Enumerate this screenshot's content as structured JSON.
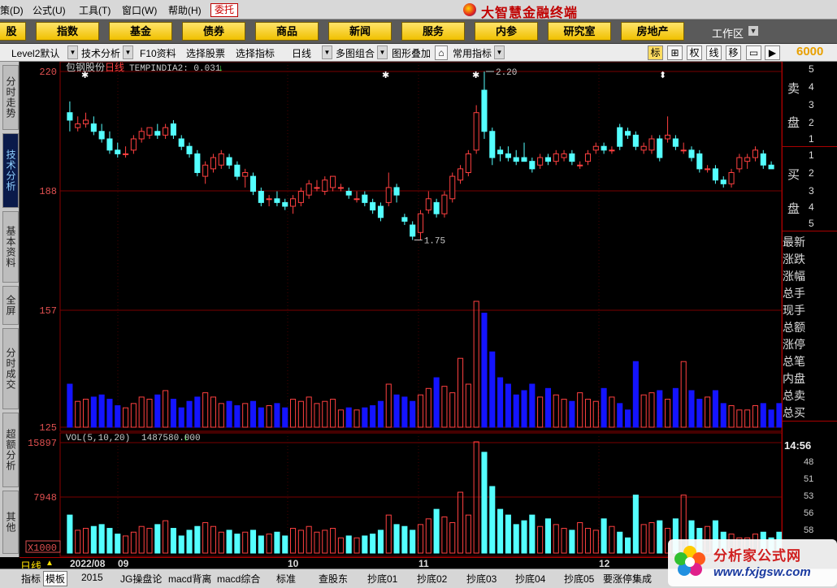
{
  "menu": [
    "策(D)",
    "公式(U)",
    "工具(T)",
    "窗口(W)",
    "帮助(H)"
  ],
  "wt_button": "委托",
  "app_title": "大智慧金融终端",
  "nav_buttons": [
    "股",
    "指数",
    "基金",
    "债券",
    "商品",
    "新闻",
    "服务",
    "内参",
    "研究室",
    "房地产"
  ],
  "workspace_label": "工作区",
  "toolbar": {
    "level2": "Level2默认",
    "tech": "技术分析",
    "f10": "F10资料",
    "select_stock": "选择股票",
    "select_indicator": "选择指标",
    "period": "日线",
    "multi": "多图组合",
    "overlay": "图形叠加",
    "common": "常用指标",
    "icons": [
      "标",
      "⊞",
      "权",
      "线",
      "移"
    ],
    "code": "6000"
  },
  "left_tabs": [
    "分时走势",
    "技术分析",
    "基本资料",
    "全屏",
    "分时成交",
    "超额分析",
    "其他"
  ],
  "chart": {
    "stock_name": "包钢股份",
    "period_tag": "日线",
    "indicator": "TEMPINDI",
    "indicator_value": "A2: 0.031",
    "price_axis": [
      "220",
      "188",
      "157",
      "125"
    ],
    "max_label": "2.20",
    "min_label": "1.75",
    "vol_label": "VOL(5,10,20)",
    "vol_value": "1487580.000",
    "vol_axis": [
      "15897",
      "7948"
    ],
    "vol_unit": "X1000",
    "colors": {
      "up": "#ff4040",
      "down": "#54ffff",
      "volume_bar": "#1414ff",
      "grid": "#7a0000"
    }
  },
  "chart_data": {
    "type": "candlestick",
    "candles": [
      {
        "o": 2.09,
        "h": 2.12,
        "l": 2.04,
        "c": 2.07
      },
      {
        "o": 2.05,
        "h": 2.08,
        "l": 2.04,
        "c": 2.06
      },
      {
        "o": 2.06,
        "h": 2.09,
        "l": 2.05,
        "c": 2.07
      },
      {
        "o": 2.06,
        "h": 2.08,
        "l": 2.03,
        "c": 2.04
      },
      {
        "o": 2.04,
        "h": 2.06,
        "l": 2.01,
        "c": 2.02
      },
      {
        "o": 2.02,
        "h": 2.04,
        "l": 1.98,
        "c": 1.99
      },
      {
        "o": 1.99,
        "h": 2.01,
        "l": 1.97,
        "c": 1.98
      },
      {
        "o": 1.98,
        "h": 2.0,
        "l": 1.97,
        "c": 1.98
      },
      {
        "o": 1.99,
        "h": 2.03,
        "l": 1.98,
        "c": 2.02
      },
      {
        "o": 2.02,
        "h": 2.05,
        "l": 2.01,
        "c": 2.04
      },
      {
        "o": 2.03,
        "h": 2.05,
        "l": 2.02,
        "c": 2.05
      },
      {
        "o": 2.04,
        "h": 2.06,
        "l": 2.02,
        "c": 2.03
      },
      {
        "o": 2.03,
        "h": 2.06,
        "l": 2.02,
        "c": 2.05
      },
      {
        "o": 2.06,
        "h": 2.07,
        "l": 2.02,
        "c": 2.03
      },
      {
        "o": 2.02,
        "h": 2.03,
        "l": 1.99,
        "c": 2.0
      },
      {
        "o": 2.0,
        "h": 2.01,
        "l": 1.97,
        "c": 1.98
      },
      {
        "o": 1.98,
        "h": 1.99,
        "l": 1.92,
        "c": 1.93
      },
      {
        "o": 1.92,
        "h": 1.96,
        "l": 1.9,
        "c": 1.95
      },
      {
        "o": 1.94,
        "h": 1.98,
        "l": 1.93,
        "c": 1.97
      },
      {
        "o": 1.95,
        "h": 1.99,
        "l": 1.94,
        "c": 1.98
      },
      {
        "o": 1.97,
        "h": 1.98,
        "l": 1.94,
        "c": 1.95
      },
      {
        "o": 1.95,
        "h": 1.96,
        "l": 1.91,
        "c": 1.92
      },
      {
        "o": 1.92,
        "h": 1.94,
        "l": 1.89,
        "c": 1.93
      },
      {
        "o": 1.92,
        "h": 1.93,
        "l": 1.87,
        "c": 1.88
      },
      {
        "o": 1.88,
        "h": 1.89,
        "l": 1.84,
        "c": 1.85
      },
      {
        "o": 1.86,
        "h": 1.87,
        "l": 1.84,
        "c": 1.86
      },
      {
        "o": 1.86,
        "h": 1.88,
        "l": 1.84,
        "c": 1.85
      },
      {
        "o": 1.85,
        "h": 1.86,
        "l": 1.83,
        "c": 1.84
      },
      {
        "o": 1.84,
        "h": 1.87,
        "l": 1.82,
        "c": 1.86
      },
      {
        "o": 1.85,
        "h": 1.89,
        "l": 1.84,
        "c": 1.88
      },
      {
        "o": 1.87,
        "h": 1.91,
        "l": 1.86,
        "c": 1.9
      },
      {
        "o": 1.89,
        "h": 1.91,
        "l": 1.88,
        "c": 1.89
      },
      {
        "o": 1.88,
        "h": 1.92,
        "l": 1.87,
        "c": 1.91
      },
      {
        "o": 1.89,
        "h": 1.92,
        "l": 1.88,
        "c": 1.92
      },
      {
        "o": 1.89,
        "h": 1.9,
        "l": 1.88,
        "c": 1.89
      },
      {
        "o": 1.88,
        "h": 1.89,
        "l": 1.86,
        "c": 1.87
      },
      {
        "o": 1.86,
        "h": 1.88,
        "l": 1.85,
        "c": 1.86
      },
      {
        "o": 1.87,
        "h": 1.88,
        "l": 1.84,
        "c": 1.85
      },
      {
        "o": 1.85,
        "h": 1.86,
        "l": 1.82,
        "c": 1.83
      },
      {
        "o": 1.84,
        "h": 1.85,
        "l": 1.8,
        "c": 1.81
      },
      {
        "o": 1.85,
        "h": 1.93,
        "l": 1.84,
        "c": 1.89
      },
      {
        "o": 1.89,
        "h": 1.9,
        "l": 1.85,
        "c": 1.87
      },
      {
        "o": 1.81,
        "h": 1.82,
        "l": 1.79,
        "c": 1.8
      },
      {
        "o": 1.79,
        "h": 1.8,
        "l": 1.75,
        "c": 1.76
      },
      {
        "o": 1.77,
        "h": 1.83,
        "l": 1.75,
        "c": 1.82
      },
      {
        "o": 1.83,
        "h": 1.88,
        "l": 1.82,
        "c": 1.86
      },
      {
        "o": 1.85,
        "h": 1.86,
        "l": 1.81,
        "c": 1.82
      },
      {
        "o": 1.82,
        "h": 1.88,
        "l": 1.81,
        "c": 1.87
      },
      {
        "o": 1.86,
        "h": 1.93,
        "l": 1.85,
        "c": 1.92
      },
      {
        "o": 1.91,
        "h": 1.95,
        "l": 1.9,
        "c": 1.94
      },
      {
        "o": 1.93,
        "h": 1.99,
        "l": 1.92,
        "c": 1.98
      },
      {
        "o": 1.99,
        "h": 2.11,
        "l": 1.98,
        "c": 2.09
      },
      {
        "o": 2.15,
        "h": 2.2,
        "l": 2.02,
        "c": 2.04
      },
      {
        "o": 2.04,
        "h": 2.05,
        "l": 1.95,
        "c": 1.97
      },
      {
        "o": 1.99,
        "h": 2.0,
        "l": 1.96,
        "c": 1.98
      },
      {
        "o": 1.98,
        "h": 2.0,
        "l": 1.96,
        "c": 1.97
      },
      {
        "o": 1.97,
        "h": 1.99,
        "l": 1.95,
        "c": 1.96
      },
      {
        "o": 1.97,
        "h": 2.01,
        "l": 1.96,
        "c": 1.96
      },
      {
        "o": 1.96,
        "h": 1.97,
        "l": 1.93,
        "c": 1.94
      },
      {
        "o": 1.95,
        "h": 1.98,
        "l": 1.94,
        "c": 1.97
      },
      {
        "o": 1.97,
        "h": 1.98,
        "l": 1.95,
        "c": 1.96
      },
      {
        "o": 1.96,
        "h": 1.99,
        "l": 1.95,
        "c": 1.98
      },
      {
        "o": 1.97,
        "h": 1.99,
        "l": 1.96,
        "c": 1.98
      },
      {
        "o": 1.98,
        "h": 1.99,
        "l": 1.95,
        "c": 1.96
      },
      {
        "o": 1.95,
        "h": 1.96,
        "l": 1.94,
        "c": 1.95
      },
      {
        "o": 1.96,
        "h": 1.99,
        "l": 1.95,
        "c": 1.98
      },
      {
        "o": 1.99,
        "h": 2.01,
        "l": 1.98,
        "c": 2.0
      },
      {
        "o": 2.0,
        "h": 2.01,
        "l": 1.98,
        "c": 1.99
      },
      {
        "o": 1.99,
        "h": 2.0,
        "l": 1.98,
        "c": 1.99
      },
      {
        "o": 2.05,
        "h": 2.06,
        "l": 1.99,
        "c": 2.0
      },
      {
        "o": 2.04,
        "h": 2.05,
        "l": 2.02,
        "c": 2.03
      },
      {
        "o": 2.03,
        "h": 2.04,
        "l": 1.99,
        "c": 2.0
      },
      {
        "o": 1.99,
        "h": 2.01,
        "l": 1.98,
        "c": 2.0
      },
      {
        "o": 1.99,
        "h": 2.03,
        "l": 1.98,
        "c": 2.02
      },
      {
        "o": 2.02,
        "h": 2.03,
        "l": 1.96,
        "c": 1.97
      },
      {
        "o": 2.02,
        "h": 2.08,
        "l": 2.01,
        "c": 2.03
      },
      {
        "o": 2.02,
        "h": 2.03,
        "l": 1.99,
        "c": 2.0
      },
      {
        "o": 1.99,
        "h": 2.01,
        "l": 1.98,
        "c": 1.99
      },
      {
        "o": 1.99,
        "h": 2.0,
        "l": 1.96,
        "c": 1.97
      },
      {
        "o": 1.98,
        "h": 1.99,
        "l": 1.93,
        "c": 1.94
      },
      {
        "o": 1.94,
        "h": 1.95,
        "l": 1.93,
        "c": 1.94
      },
      {
        "o": 1.94,
        "h": 1.95,
        "l": 1.9,
        "c": 1.91
      },
      {
        "o": 1.91,
        "h": 1.92,
        "l": 1.89,
        "c": 1.9
      },
      {
        "o": 1.9,
        "h": 1.94,
        "l": 1.89,
        "c": 1.93
      },
      {
        "o": 1.94,
        "h": 1.98,
        "l": 1.93,
        "c": 1.97
      },
      {
        "o": 1.96,
        "h": 1.98,
        "l": 1.94,
        "c": 1.97
      },
      {
        "o": 1.97,
        "h": 2.0,
        "l": 1.96,
        "c": 1.99
      },
      {
        "o": 1.98,
        "h": 1.99,
        "l": 1.94,
        "c": 1.95
      },
      {
        "o": 1.95,
        "h": 1.96,
        "l": 1.94,
        "c": 1.94
      }
    ],
    "volume": [
      4.0,
      2.4,
      2.6,
      2.8,
      3.0,
      2.6,
      2.0,
      1.8,
      2.2,
      2.8,
      2.6,
      3.0,
      3.4,
      2.6,
      1.8,
      2.4,
      2.8,
      3.2,
      2.8,
      2.2,
      2.4,
      2.0,
      2.2,
      2.4,
      1.8,
      2.0,
      2.2,
      1.8,
      2.6,
      2.4,
      2.8,
      2.2,
      2.4,
      2.6,
      1.6,
      1.8,
      1.6,
      1.8,
      2.0,
      2.4,
      4.0,
      3.0,
      2.8,
      2.4,
      3.0,
      3.6,
      4.6,
      3.8,
      3.2,
      6.4,
      4.0,
      11.7,
      10.6,
      7.0,
      4.6,
      4.0,
      3.0,
      3.4,
      4.0,
      2.8,
      3.6,
      3.0,
      2.6,
      2.4,
      3.2,
      2.6,
      2.4,
      3.6,
      2.8,
      2.2,
      1.6,
      6.1,
      3.0,
      3.2,
      3.4,
      2.6,
      3.6,
      6.1,
      3.4,
      2.6,
      2.8,
      3.4,
      2.2,
      2.0,
      1.6,
      1.6,
      2.0,
      2.2,
      1.6,
      2.2,
      1.6
    ],
    "vol_ylim": [
      0,
      15897
    ],
    "ylim": [
      1.25,
      2.2
    ],
    "x_ticks": [
      "2022/08",
      "09",
      "10",
      "11",
      "12"
    ]
  },
  "right_panel": {
    "sell_label": [
      "卖",
      "盘"
    ],
    "buy_label": [
      "买",
      "盘"
    ],
    "sell_levels": [
      "5",
      "4",
      "3",
      "2",
      "1"
    ],
    "buy_levels": [
      "1",
      "2",
      "3",
      "4",
      "5"
    ],
    "fields": [
      "最新",
      "涨跌",
      "涨幅",
      "总手",
      "现手",
      "总额",
      "涨停",
      "总笔",
      "内盘",
      "总卖",
      "总买"
    ],
    "time": "14:56",
    "ticks": [
      "48",
      "51",
      "53",
      "56",
      "58"
    ]
  },
  "period_label": "日线",
  "bottom_tabs": [
    "指标",
    "模板",
    "2015",
    "JG操盘论",
    "macd背离",
    "macd综合",
    "标准",
    "查股东",
    "抄底01",
    "抄底02",
    "抄底03",
    "抄底04",
    "抄底05",
    "要涨停集成"
  ],
  "watermark": {
    "title": "分析家公式网",
    "url": "www.fxjgsw.com"
  }
}
